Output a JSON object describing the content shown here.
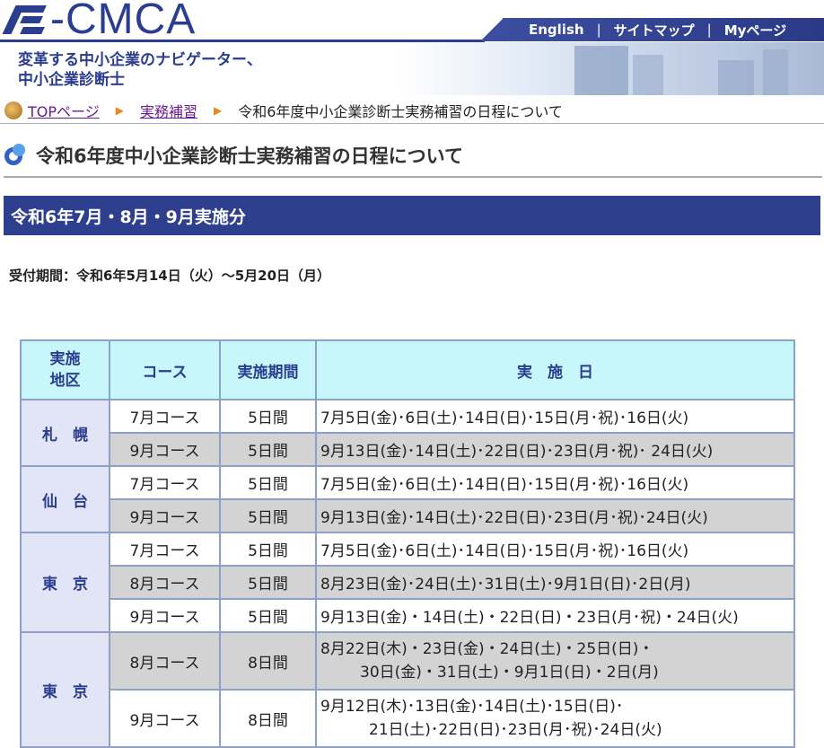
{
  "header": {
    "logo_text": "-CMCA",
    "tagline_line1": "変革する中小企業のナビゲーター、",
    "tagline_line2": "中小企業診断士",
    "nav": [
      "English",
      "サイトマップ",
      "Myページ"
    ],
    "nav_separator": "|"
  },
  "breadcrumb": {
    "items": [
      "TOPページ",
      "実務補習"
    ],
    "current": "令和6年度中小企業診断士実務補習の日程について",
    "arrow": "▶"
  },
  "page_title": "令和6年度中小企業診断士実務補習の日程について",
  "section": {
    "title": "令和6年7月・8月・9月実施分",
    "reception": "受付期間：令和6年5月14日（火）～5月20日（月）"
  },
  "table": {
    "headers": {
      "region_line1": "実施",
      "region_line2": "地区",
      "course": "コース",
      "period": "実施期間",
      "dates": "実　施　日"
    },
    "groups": [
      {
        "region": "札　幌",
        "rows": [
          {
            "course": "7月コース",
            "period": "5日間",
            "dates": [
              "7月5日(金)･6日(土)･14日(日)･15日(月･祝)･16日(火)"
            ]
          },
          {
            "course": "9月コース",
            "period": "5日間",
            "dates": [
              "9月13日(金)･14日(土)･22日(日)･23日(月･祝)･ 24日(火)"
            ]
          }
        ]
      },
      {
        "region": "仙　台",
        "rows": [
          {
            "course": "7月コース",
            "period": "5日間",
            "dates": [
              "7月5日(金)･6日(土)･14日(日)･15日(月･祝)･16日(火)"
            ]
          },
          {
            "course": "9月コース",
            "period": "5日間",
            "dates": [
              "9月13日(金)･14日(土)･22日(日)･23日(月･祝)･24日(火)"
            ]
          }
        ]
      },
      {
        "region": "東　京",
        "rows": [
          {
            "course": "7月コース",
            "period": "5日間",
            "dates": [
              "7月5日(金)･6日(土)･14日(日)･15日(月･祝)･16日(火)"
            ]
          },
          {
            "course": "8月コース",
            "period": "5日間",
            "dates": [
              "8月23日(金)･24日(土)･31日(土)･9月1日(日)･2日(月)"
            ]
          },
          {
            "course": "9月コース",
            "period": "5日間",
            "dates": [
              "9月13日(金)・14日(土)・22日(日)・23日(月･祝)・24日(火)"
            ]
          }
        ]
      },
      {
        "region": "東　京",
        "rows": [
          {
            "course": "8月コース",
            "period": "8日間",
            "dates": [
              "8月22日(木)・23日(金)・24日(土)・25日(日)・",
              "30日(金)・31日(土)・9月1日(日)・2日(月)"
            ]
          },
          {
            "course": "9月コース",
            "period": "8日間",
            "dates": [
              "9月12日(木)･13日(金)･14日(土)･15日(日)･",
              "21日(土)･22日(日)･23日(月･祝)･24日(火)"
            ]
          }
        ]
      }
    ]
  }
}
